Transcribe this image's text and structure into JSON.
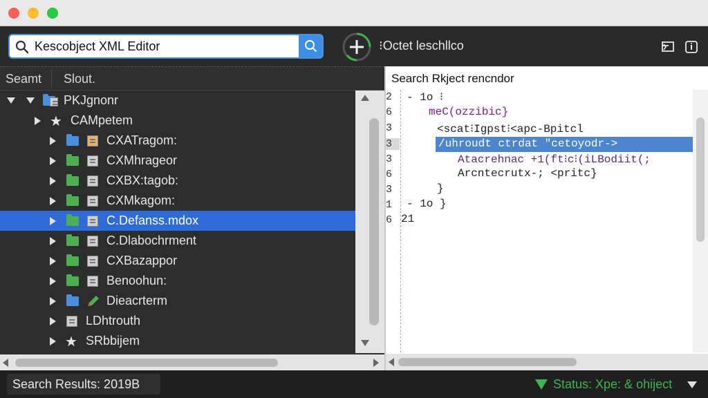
{
  "colors": {
    "accent": "#3d8ee6",
    "selection": "#2e6bd6",
    "status": "#3fb34f",
    "folder_blue": "#4a8fe0",
    "folder_green": "#4caf50"
  },
  "search": {
    "value": "Kescobject XML Editor"
  },
  "toolbar": {
    "add_label": "⁝Octet leschllco"
  },
  "left_header": {
    "tab1": "Seamt",
    "tab2": "Slout."
  },
  "tree": {
    "items": [
      {
        "label": "PKJgnonr",
        "icon": "folder-doc-icon",
        "folder_color": "blue",
        "expanded": true
      },
      {
        "label": "CAMpetem",
        "icon": "star-icon",
        "expanded": false
      },
      {
        "label": "CXATragom:",
        "icon": "image-icon",
        "folder_color": "blue"
      },
      {
        "label": "CXMhrageor",
        "icon": "doc-icon",
        "folder_color": "green"
      },
      {
        "label": "CXBX:tagob:",
        "icon": "doc-icon",
        "folder_color": "green"
      },
      {
        "label": "CXMkagom:",
        "icon": "doc-icon",
        "folder_color": "green"
      },
      {
        "label": "C.Defanss.mdox",
        "icon": "doc-icon",
        "folder_color": "green",
        "selected": true
      },
      {
        "label": "C.Dlabochrment",
        "icon": "doc-icon",
        "folder_color": "green"
      },
      {
        "label": "CXBazappor",
        "icon": "doc-icon",
        "folder_color": "green"
      },
      {
        "label": "Benoohun:",
        "icon": "doc-icon",
        "folder_color": "green"
      },
      {
        "label": "Dieacrterm",
        "icon": "pencil-icon",
        "folder_color": "blue"
      },
      {
        "label": "LDhtrouth",
        "icon": "doc-icon"
      },
      {
        "label": "SRbbijem",
        "icon": "star-icon"
      }
    ]
  },
  "editor": {
    "title": "Search Rkject rencndor",
    "line_numbers": [
      "2",
      "6",
      "3",
      "3",
      "3",
      "6",
      "3",
      "1",
      "6"
    ],
    "lines": [
      {
        "text": "- 1o ⁝",
        "color": "#222"
      },
      {
        "text": "meC(ozzibic}",
        "color": "#7a1f8a"
      },
      {
        "text": "<scat⁝Igpst⁝<apc-Bpitcl",
        "color": "#222"
      },
      {
        "text": "/uhroudt ctrdat \"cetoyodr->",
        "color": "#ffffff"
      },
      {
        "text": "Atacrehnac +1(ft⁝c⁝(iLBodiit(;",
        "color": "#5a2a82"
      },
      {
        "text": "Arcntecrutx-; <pritc}",
        "color": "#222"
      },
      {
        "text": "}",
        "color": "#222"
      },
      {
        "text": "- 1o }",
        "color": "#222"
      },
      {
        "text": "21",
        "color": "#222"
      }
    ]
  },
  "status": {
    "results": "Search Results: 2019B",
    "text": "Status: Xpe: & ohiject"
  }
}
